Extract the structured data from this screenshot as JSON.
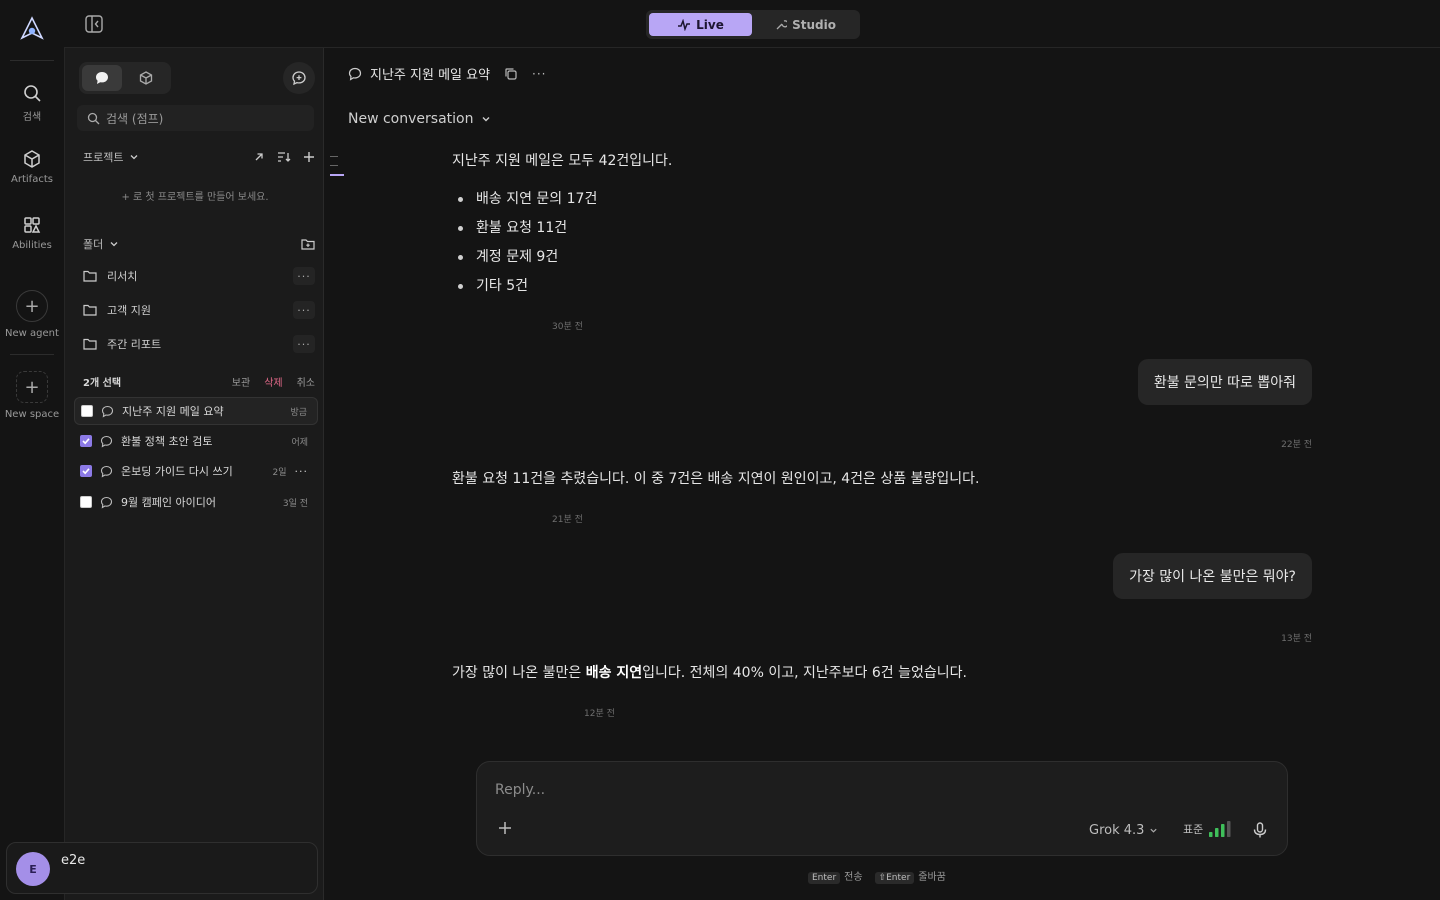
{
  "rail": {
    "items": [
      {
        "label": "검색"
      },
      {
        "label": "Artifacts"
      },
      {
        "label": "Abilities"
      },
      {
        "label": "New agent"
      },
      {
        "label": "New space"
      }
    ]
  },
  "topbar": {
    "modes": [
      {
        "label": "Live",
        "active": true
      },
      {
        "label": "Studio",
        "active": false
      }
    ]
  },
  "sidebar": {
    "search_placeholder": "검색 (점프)",
    "projects_label": "프로젝트",
    "empty_projects": "+ 로 첫 프로젝트를 만들어 보세요.",
    "folders_label": "폴더",
    "folders": [
      {
        "name": "리서치"
      },
      {
        "name": "고객 지원"
      },
      {
        "name": "주간 리포트"
      }
    ],
    "selection": {
      "count_label": "2개 선택",
      "archive": "보관",
      "delete": "삭제",
      "cancel": "취소"
    },
    "conversations": [
      {
        "title": "지난주 지원 메일 요약",
        "time": "방금",
        "checked": false
      },
      {
        "title": "환불 정책 초안 검토",
        "time": "어제",
        "checked": true
      },
      {
        "title": "온보딩 가이드 다시 쓰기",
        "time": "2일",
        "checked": true
      },
      {
        "title": "9월 캠페인 아이디어",
        "time": "3일 전",
        "checked": false
      }
    ],
    "profile": {
      "initial": "E",
      "name": "e2e"
    }
  },
  "main": {
    "title": "지난주 지원 메일 요약",
    "conversation_selector": "New conversation",
    "messages": [
      {
        "role": "assistant",
        "text": "지난주 지원 메일은 모두 42건입니다.",
        "bullets": [
          "배송 지연 문의 17건",
          "환불 요청 11건",
          "계정 문제 9건",
          "기타 5건"
        ],
        "time": "30분 전"
      },
      {
        "role": "user",
        "text": "환불 문의만 따로 뽑아줘",
        "time": "22분 전"
      },
      {
        "role": "assistant",
        "text": "환불 요청 11건을 추렸습니다. 이 중 7건은 배송 지연이 원인이고, 4건은 상품 불량입니다.",
        "time": "21분 전"
      },
      {
        "role": "user",
        "text": "가장 많이 나온 불만은 뭐야?",
        "time": "13분 전"
      },
      {
        "role": "assistant",
        "text_prefix": "가장 많이 나온 불만은 ",
        "text_bold": "배송 지연",
        "text_suffix": "입니다. 전체의 40% 이고, 지난주보다 6건 늘었습니다.",
        "time": "12분 전"
      }
    ],
    "composer": {
      "placeholder": "Reply...",
      "model": "Grok 4.3",
      "quality": "표준"
    },
    "hints": [
      {
        "key": "Enter",
        "label": "전송"
      },
      {
        "key": "⇧Enter",
        "label": "줄바꿈"
      }
    ]
  },
  "colors": {
    "accent": "#b8a6f5",
    "danger": "#e46a8a",
    "signal": "#3fbf5a"
  }
}
